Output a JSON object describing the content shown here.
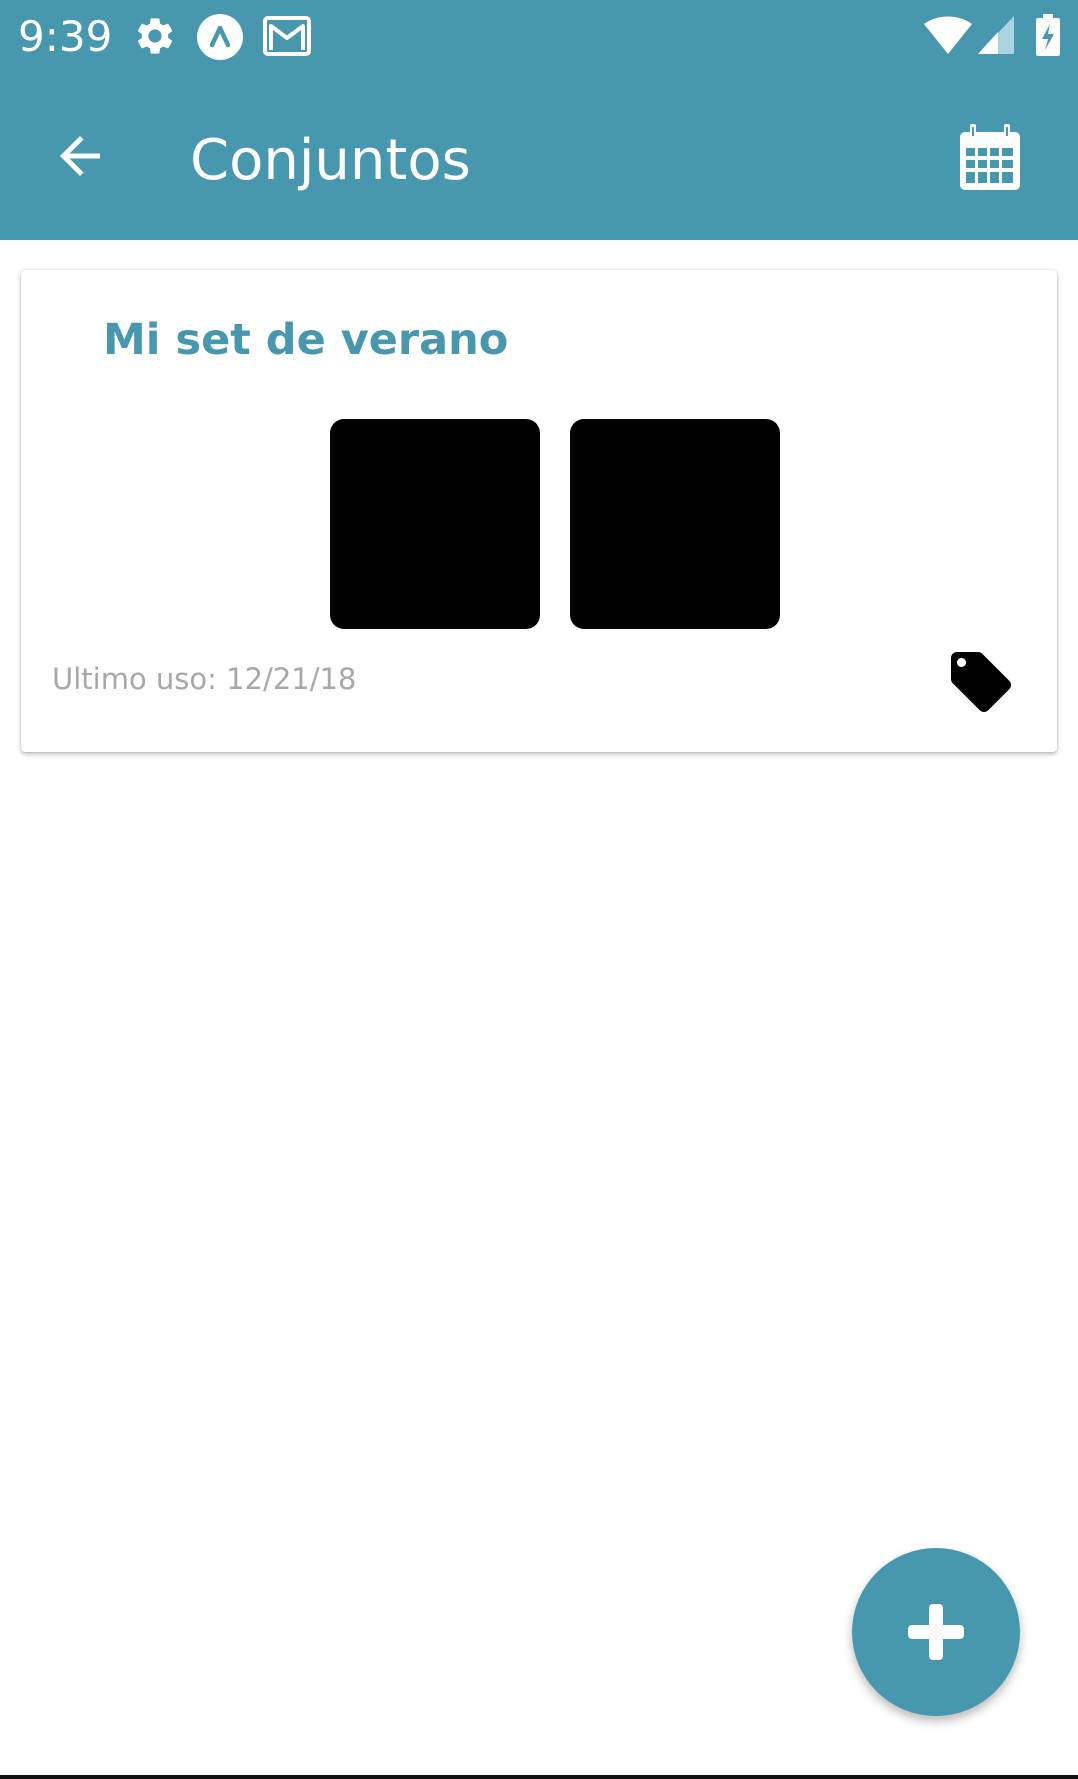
{
  "status_bar": {
    "time": "9:39",
    "icons": [
      "settings-icon",
      "app-notification-icon",
      "gmail-icon",
      "wifi-icon",
      "cell-signal-icon",
      "battery-charging-icon"
    ]
  },
  "toolbar": {
    "title": "Conjuntos",
    "back_icon": "arrow-back-icon",
    "action_icon": "calendar-icon"
  },
  "sets": [
    {
      "title": "Mi set de verano",
      "last_used": "Ultimo uso: 12/21/18",
      "thumbnail_count": 2,
      "tag_icon": "tag-icon"
    }
  ],
  "fab": {
    "icon": "plus-icon"
  },
  "colors": {
    "primary": "#4798ae",
    "meta_text": "#a8a8a8",
    "background": "#ffffff"
  }
}
